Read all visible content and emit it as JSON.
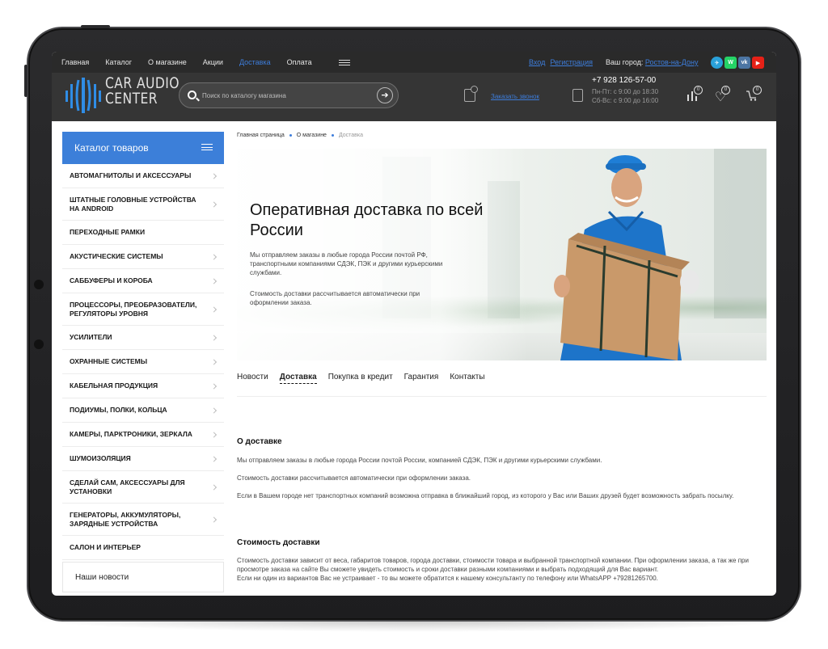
{
  "topbar": {
    "nav": [
      "Главная",
      "Каталог",
      "О магазине",
      "Акции",
      "Доставка",
      "Оплата"
    ],
    "active_nav": "Доставка",
    "login": "Вход",
    "register": "Регистрация",
    "city_label": "Ваш город:",
    "city_value": "Ростов-на-Дону",
    "social": [
      {
        "name": "telegram",
        "color": "#2aa1da",
        "glyph": "✈"
      },
      {
        "name": "whatsapp",
        "color": "#25d366",
        "glyph": "W"
      },
      {
        "name": "vk",
        "color": "#4c75a3",
        "glyph": "vk"
      },
      {
        "name": "youtube",
        "color": "#e62117",
        "glyph": "▶"
      }
    ]
  },
  "header": {
    "logo_line1": "CAR AUDIO",
    "logo_line2": "CENTER",
    "search_placeholder": "Поиск по каталогу магазина",
    "callback_label": "Заказать звонок",
    "phone": "+7 928 126-57-00",
    "hours_weekdays": "Пн-Пт: с 9:00 до 18:30",
    "hours_weekend": "Сб-Вс: с 9:00 до 16:00",
    "compare_count": "0",
    "favorites_count": "0",
    "cart_count": "0"
  },
  "sidebar": {
    "title": "Каталог товаров",
    "items": [
      {
        "label": "АВТОМАГНИТОЛЫ И АКСЕССУАРЫ",
        "chevron": true
      },
      {
        "label": "ШТАТНЫЕ ГОЛОВНЫЕ УСТРОЙСТВА НА ANDROID",
        "chevron": true
      },
      {
        "label": "ПЕРЕХОДНЫЕ РАМКИ",
        "chevron": false
      },
      {
        "label": "АКУСТИЧЕСКИЕ СИСТЕМЫ",
        "chevron": true
      },
      {
        "label": "САББУФЕРЫ И КОРОБА",
        "chevron": true
      },
      {
        "label": "ПРОЦЕССОРЫ, ПРЕОБРАЗОВАТЕЛИ, РЕГУЛЯТОРЫ УРОВНЯ",
        "chevron": true
      },
      {
        "label": "УСИЛИТЕЛИ",
        "chevron": true
      },
      {
        "label": "ОХРАННЫЕ СИСТЕМЫ",
        "chevron": true
      },
      {
        "label": "КАБЕЛЬНАЯ ПРОДУКЦИЯ",
        "chevron": true
      },
      {
        "label": "ПОДИУМЫ, ПОЛКИ, КОЛЬЦА",
        "chevron": true
      },
      {
        "label": "КАМЕРЫ, ПАРКТРОНИКИ, ЗЕРКАЛА",
        "chevron": true
      },
      {
        "label": "ШУМОИЗОЛЯЦИЯ",
        "chevron": true
      },
      {
        "label": "СДЕЛАЙ САМ, АКСЕССУАРЫ ДЛЯ УСТАНОВКИ",
        "chevron": true
      },
      {
        "label": "ГЕНЕРАТОРЫ, АККУМУЛЯТОРЫ, ЗАРЯДНЫЕ УСТРОЙСТВА",
        "chevron": true
      },
      {
        "label": "САЛОН И ИНТЕРЬЕР",
        "chevron": false
      }
    ],
    "news": "Наши новости"
  },
  "breadcrumb": [
    "Главная страница",
    "О магазине",
    "Доставка"
  ],
  "hero": {
    "title": "Оперативная доставка по всей России",
    "p1": "Мы отправляем заказы в любые города России почтой РФ, транспортными компаниями СДЭК, ПЭК и другими курьерскими службами.",
    "p2": "Стоимость доставки рассчитывается автоматически при оформлении заказа."
  },
  "tabs": [
    "Новости",
    "Доставка",
    "Покупка в кредит",
    "Гарантия",
    "Контакты"
  ],
  "active_tab": "Доставка",
  "about": {
    "heading": "О доставке",
    "p1": "Мы отправляем заказы в любые города России почтой России, компанией СДЭК, ПЭК и другими курьерскими службами.",
    "p2": "Стоимость доставки рассчитывается автоматически при оформлении заказа.",
    "p3": "Если в Вашем городе нет транспортных компаний возможна отправка в ближайший город, из которого у Вас или Ваших друзей будет возможность забрать посылку."
  },
  "cost": {
    "heading": "Стоимость доставки",
    "p1": "Стоимость доставки зависит от веса, габаритов товаров, города доставки, стоимости товара и выбранной транспортной компании. При оформлении заказа, а так же при просмотре заказа на сайте Вы сможете увидеть стоимость и сроки доставки разными компаниями и выбрать подходящий для Вас вариант.",
    "p2": "Если ни один из вариантов Вас не устраивает - то вы можете обратится к нашему консультанту по телефону или WhatsAPP +79281265700."
  },
  "colors": {
    "accent": "#3c7fd9",
    "header_bg": "#353535",
    "topbar_bg": "#2a2a2a"
  }
}
